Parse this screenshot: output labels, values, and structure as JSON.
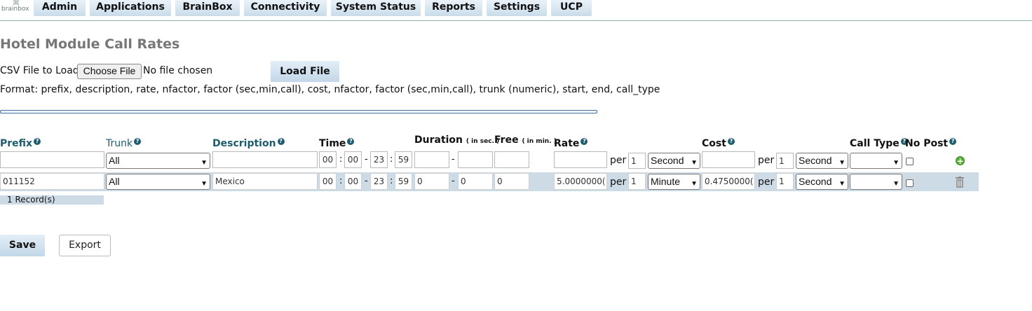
{
  "nav": {
    "logo_text": "brainbox",
    "tabs": [
      "Admin",
      "Applications",
      "BrainBox",
      "Connectivity",
      "System Status",
      "Reports",
      "Settings",
      "UCP"
    ]
  },
  "page_title": "Hotel Module Call Rates",
  "upload": {
    "csv_label": "CSV File to Load:",
    "choose_button": "Choose File",
    "file_status": "No file chosen",
    "load_button": "Load File",
    "format_text": "Format: prefix, description, rate, nfactor, factor (sec,min,call), cost, nfactor, factor (sec,min,call), trunk (numeric), start, end, call_type"
  },
  "headers": {
    "prefix": "Prefix",
    "trunk": "Trunk",
    "description": "Description",
    "time": "Time",
    "duration": "Duration",
    "duration_unit": "( in sec. )",
    "free": "Free",
    "free_unit": "( in min. )",
    "rate": "Rate",
    "cost": "Cost",
    "call_type": "Call Type",
    "no_post": "No Post",
    "help_icon": "?"
  },
  "separators": {
    "colon": ":",
    "dash": "-",
    "per": "per"
  },
  "filter_row": {
    "prefix": "",
    "trunk": "All",
    "description": "",
    "start_hour": "00",
    "start_min": "00",
    "end_hour": "23",
    "end_min": "59",
    "duration_from": "",
    "duration_to": "",
    "free": "",
    "rate": "",
    "rate_per": "1",
    "rate_unit": "Second",
    "cost": "",
    "cost_per": "1",
    "cost_unit": "Second",
    "call_type": "",
    "no_post": false
  },
  "rows": [
    {
      "prefix": "011152",
      "trunk": "All",
      "description": "Mexico",
      "start_hour": "00",
      "start_min": "00",
      "end_hour": "23",
      "end_min": "59",
      "duration_from": "0",
      "duration_to": "0",
      "free": "0",
      "rate": "5.0000000(",
      "rate_per": "1",
      "rate_unit": "Minute",
      "cost": "0.4750000(",
      "cost_per": "1",
      "cost_unit": "Second",
      "call_type": "",
      "no_post": false
    }
  ],
  "records_text": "1 Record(s)",
  "actions": {
    "save": "Save",
    "export": "Export"
  },
  "icons": {
    "add": "add-circle-icon",
    "delete": "trash-icon",
    "help": "question-circle-icon"
  },
  "colors": {
    "accent": "#1d5c6e",
    "row_highlight": "#cddbe6",
    "button_bg": "#c9dcea"
  }
}
